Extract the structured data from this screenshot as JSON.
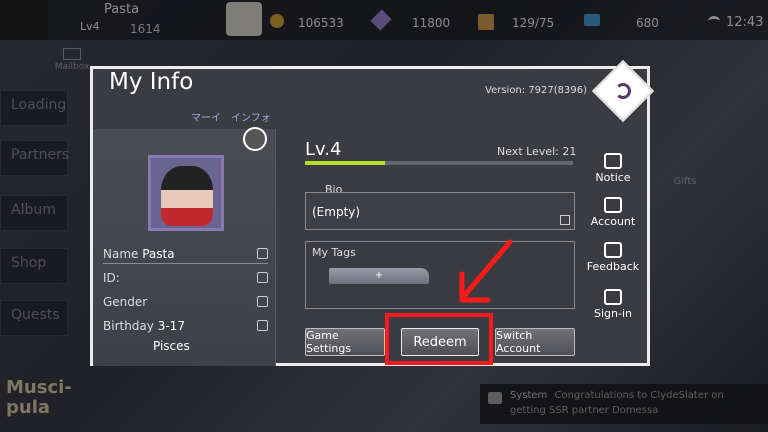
{
  "topbar": {
    "player_name": "Pasta",
    "level_short": "Lv4",
    "power": "1614",
    "gold": "106533",
    "crystals": "11800",
    "stamina": "129/75",
    "gems": "680",
    "time": "12:43"
  },
  "background": {
    "mailbox": "Mailbox",
    "menu": [
      "Loading",
      "Partners",
      "Album",
      "Shop",
      "Quests"
    ],
    "gifts": "Gifts",
    "game_logo": "Musci-pula",
    "system_prefix": "System",
    "system_message": "Congratulations to ClydeSlater on getting SSR partner Domessa"
  },
  "dialog": {
    "title": "My Info",
    "subtitle": "マーイ　インフォ",
    "version": "Version: 7927(8396)",
    "level": "Lv.4",
    "next_level": "Next Level: 21",
    "level_progress": 0.3,
    "bio_label": "Bio",
    "bio_value": "(Empty)",
    "tags_label": "My Tags",
    "tags_add": "+",
    "fields": {
      "name_label": "Name",
      "name_value": "Pasta",
      "id_label": "ID:",
      "gender_label": "Gender",
      "birthday_label": "Birthday",
      "birthday_value": "3-17",
      "zodiac": "Pisces"
    },
    "side": {
      "notice": "Notice",
      "account": "Account",
      "feedback": "Feedback",
      "signin": "Sign-in"
    },
    "buttons": {
      "game_settings": "Game Settings",
      "redeem": "Redeem",
      "switch_account": "Switch Account"
    }
  },
  "colors": {
    "accent_progress": "#b6e027",
    "highlight": "#ff1a1a"
  }
}
